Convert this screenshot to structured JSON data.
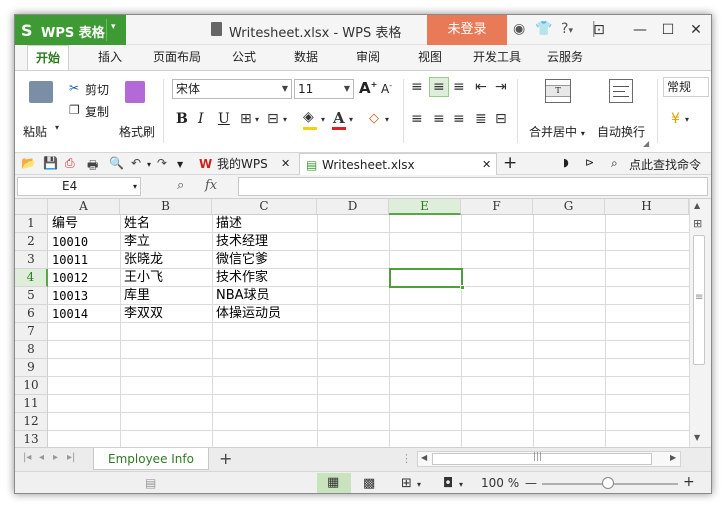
{
  "app": {
    "logo": "S",
    "name": "WPS 表格",
    "menu_arrow": "▾"
  },
  "title": {
    "document": "Writesheet.xlsx - WPS 表格"
  },
  "login": {
    "label": "未登录"
  },
  "window_controls": {
    "min": "—",
    "max": "☐",
    "close": "✕"
  },
  "title_icons": {
    "help": "?",
    "help_arrow": "▾"
  },
  "tabs": [
    {
      "label": "开始"
    },
    {
      "label": "插入"
    },
    {
      "label": "页面布局"
    },
    {
      "label": "公式"
    },
    {
      "label": "数据"
    },
    {
      "label": "审阅"
    },
    {
      "label": "视图"
    },
    {
      "label": "开发工具"
    },
    {
      "label": "云服务"
    }
  ],
  "ribbon": {
    "paste": "粘贴",
    "cut": "剪切",
    "copy": "复制",
    "format_painter": "格式刷",
    "font_name": "宋体",
    "font_size": "11",
    "grow_font": "A",
    "shrink_font": "A",
    "bold": "B",
    "italic": "I",
    "underline": "U",
    "merge_center": "合并居中",
    "wrap_text": "自动换行",
    "number_format": "常规"
  },
  "doc_tabs": [
    {
      "label": "我的WPS"
    },
    {
      "label": "Writesheet.xlsx"
    }
  ],
  "command_search": {
    "label": "点此查找命令"
  },
  "formula_bar": {
    "name_box": "E4",
    "fx": "fx",
    "value": ""
  },
  "columns": [
    "A",
    "B",
    "C",
    "D",
    "E",
    "F",
    "G",
    "H"
  ],
  "rows": [
    "1",
    "2",
    "3",
    "4",
    "5",
    "6",
    "7",
    "8",
    "9",
    "10",
    "11",
    "12",
    "13"
  ],
  "table": [
    [
      "编号",
      "姓名",
      "描述"
    ],
    [
      "10010",
      "李立",
      "技术经理"
    ],
    [
      "10011",
      "张晓龙",
      "微信它爹"
    ],
    [
      "10012",
      "王小飞",
      "技术作家"
    ],
    [
      "10013",
      "库里",
      "NBA球员"
    ],
    [
      "10014",
      "李双双",
      "体操运动员"
    ]
  ],
  "selected_cell": "E4",
  "sheets": [
    {
      "label": "Employee Info"
    }
  ],
  "add_sheet": "+",
  "zoom": {
    "label": "100 %",
    "minus": "—",
    "plus": "+",
    "level": 0.5
  },
  "colors": {
    "accent": "#3e9a33",
    "login": "#e87a58",
    "selection": "#4f9e3a"
  }
}
